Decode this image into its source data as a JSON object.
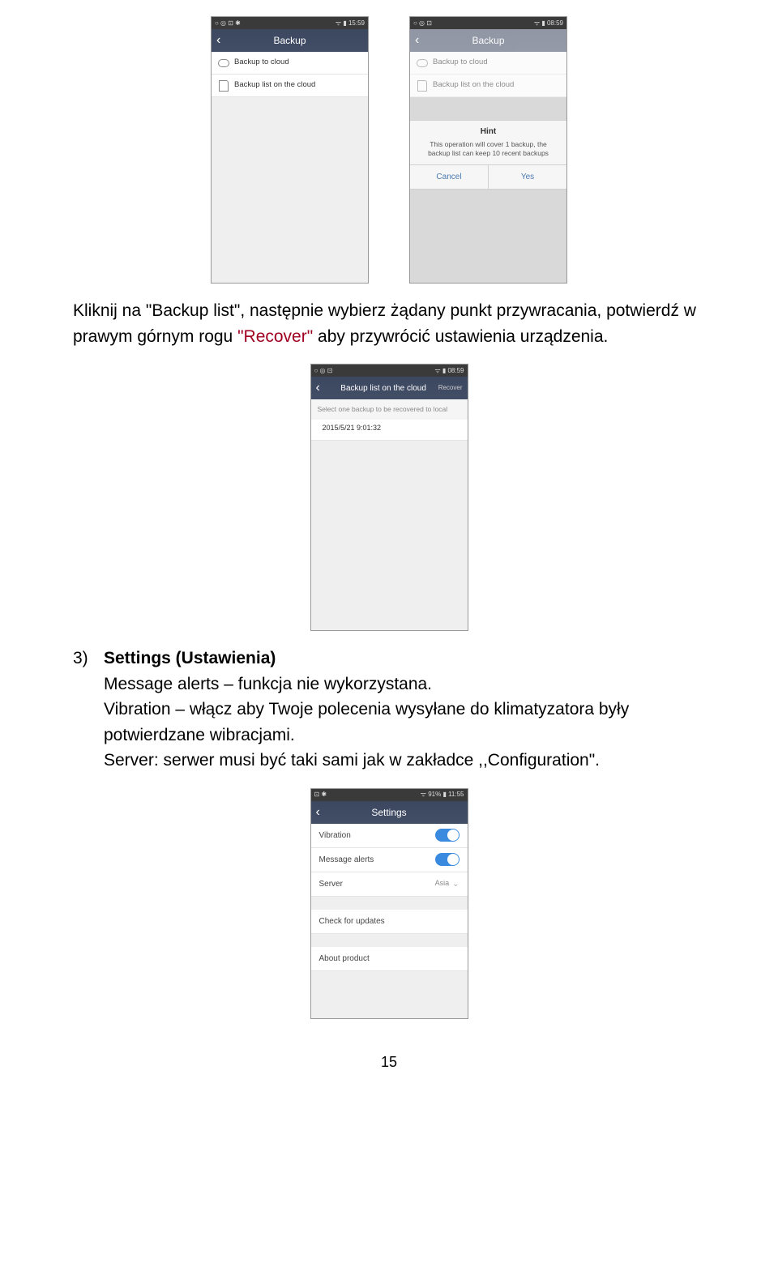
{
  "screens": {
    "s1": {
      "status_left": "○ ◎ ⊡ ✱",
      "status_right": "ᯤ ▮ 15:59",
      "title": "Backup",
      "row1": "Backup to cloud",
      "row2": "Backup list on the cloud"
    },
    "s2": {
      "status_left": "○ ◎ ⊡",
      "status_right": "ᯤ ▮ 08:59",
      "title": "Backup",
      "row1": "Backup to cloud",
      "row2": "Backup list on the cloud",
      "hint_title": "Hint",
      "hint_body": "This operation will cover 1 backup, the backup list can keep 10 recent backups",
      "btn_cancel": "Cancel",
      "btn_yes": "Yes"
    },
    "s3": {
      "status_left": "○ ◎ ⊡",
      "status_right": "ᯤ ▮ 08:59",
      "title": "Backup list on the cloud",
      "title_action": "Recover",
      "subtext": "Select one backup to be recovered to local",
      "timestamp": "2015/5/21 9:01:32"
    },
    "s4": {
      "status_left": "⊡ ✱",
      "status_right": "ᯤ 91% ▮ 11:55",
      "title": "Settings",
      "row_vibration": "Vibration",
      "row_msg": "Message alerts",
      "row_server": "Server",
      "row_server_val": "Asia",
      "row_check": "Check for updates",
      "row_about": "About product"
    }
  },
  "text": {
    "para1a": "Kliknij na \"Backup list\", następnie wybierz żądany punkt przywracania, potwierdź w prawym górnym rogu ",
    "para1_recover": "\"Recover\"",
    "para1b": " aby przywrócić ustawienia urządzenia.",
    "item3_num": "3)",
    "item3_title": "Settings (Ustawienia)",
    "item3_line1": "Message alerts – funkcja nie wykorzystana.",
    "item3_line2": "Vibration – włącz aby Twoje polecenia wysyłane do klimatyzatora były potwierdzane wibracjami.",
    "item3_line3": "Server: serwer musi być taki sami jak w zakładce ,,Configuration\"."
  },
  "pagenum": "15"
}
